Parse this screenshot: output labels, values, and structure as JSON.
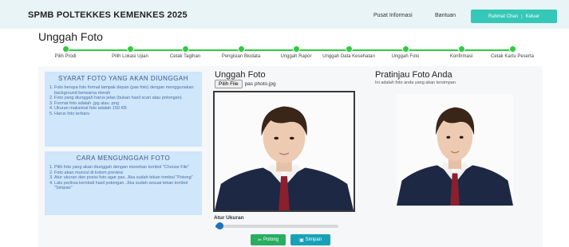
{
  "header": {
    "brand": "SPMB POLTEKKES KEMENKES 2025",
    "nav": [
      "Pusat Informasi",
      "Bantuan"
    ],
    "user_button": [
      "Rahmat Chan",
      "Keluar"
    ]
  },
  "page_title": "Unggah Foto",
  "steps": [
    {
      "label": "Pilih Prodi"
    },
    {
      "label": "Pilih Lokasi Ujian"
    },
    {
      "label": "Cetak Tagihan"
    },
    {
      "label": "Pengisian Biodata"
    },
    {
      "label": "Unggah Rapor"
    },
    {
      "label": "Unggah Data Kesehatan"
    },
    {
      "label": "Unggah Foto"
    },
    {
      "label": "Konfirmasi"
    },
    {
      "label": "Cetak Kartu Peserta"
    }
  ],
  "requirements": {
    "title": "SYARAT FOTO YANG AKAN DIUNGGAH",
    "items": [
      "Foto berupa foto formal tampak depan (pas foto) dengan menggunakan background berwarna merah",
      "Foto yang diunggah harus jelas (bukan hasil scan atau potongan)",
      "Format foto adalah .jpg atau .png",
      "Ukuran maksimal foto adalah 150 KB",
      "Harus foto terbaru"
    ]
  },
  "howto": {
    "title": "CARA MENGUNGGAH FOTO",
    "items": [
      "Pilih foto yang akan diunggah dengan menekan tombol \"Choose File\"",
      "Foto akan muncul di kolom preview",
      "Atur ukuran dan posisi foto agar pas. Jika sudah tekan tombol \"Potong\"",
      "Lalu periksa kembali hasil potongan. Jika sudah sesuai tekan tombol \"Simpan\""
    ]
  },
  "upload": {
    "title": "Unggah Foto",
    "choose_label": "Pilih File",
    "file_name": "pas photo.jpg"
  },
  "preview": {
    "title": "Pratinjau Foto Anda",
    "subtitle": "Ini adalah foto anda yang akan tersimpan"
  },
  "resize": {
    "label": "Atur Ukuran",
    "value_percent": 3
  },
  "actions": {
    "crop_label": "Potong",
    "save_label": "Simpan"
  },
  "icons": {
    "crop": "crop-icon",
    "save": "save-icon"
  },
  "colors": {
    "accent": "#35c7b7",
    "step": "#2ecc40",
    "info": "#cfe6fb",
    "crop": "#27ae60",
    "save": "#17a2b8"
  }
}
